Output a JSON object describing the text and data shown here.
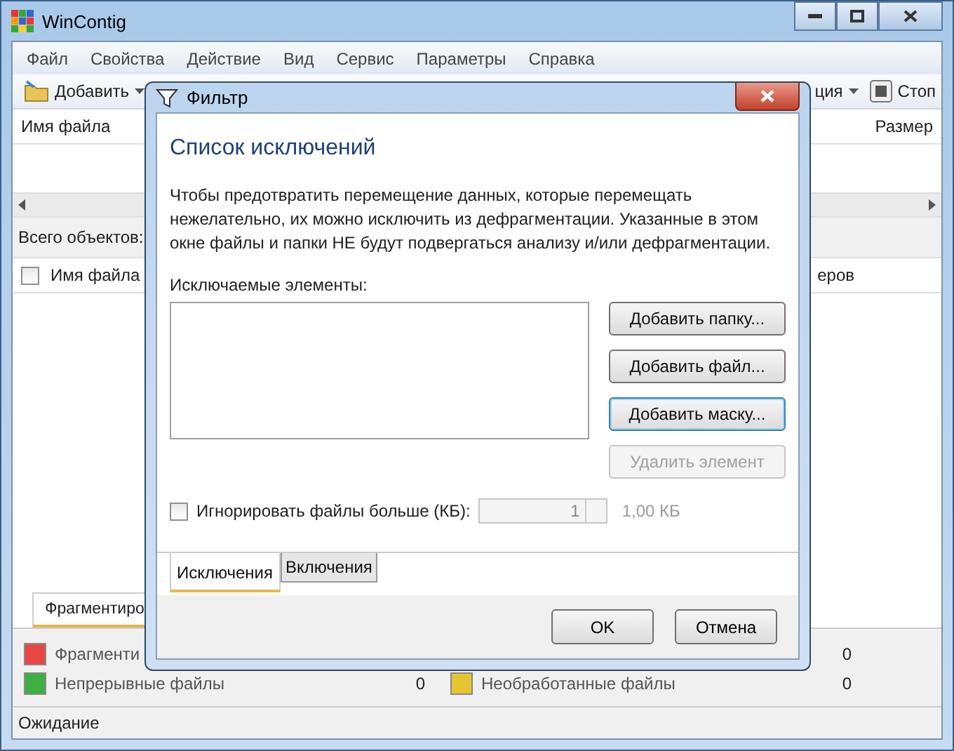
{
  "window": {
    "title": "WinContig"
  },
  "menu": [
    "Файл",
    "Свойства",
    "Действие",
    "Вид",
    "Сервис",
    "Параметры",
    "Справка"
  ],
  "toolbar": [
    {
      "label": "Добавить",
      "dropdown": true
    },
    {
      "label": "ция",
      "dropdown": true
    },
    {
      "label": "Стоп",
      "dropdown": false
    }
  ],
  "file_list": {
    "columns": [
      "Имя файла",
      "Размер"
    ]
  },
  "total_label": "Всего объектов:",
  "second_list": {
    "columns": [
      {
        "label": "Имя файла",
        "checked": false
      },
      {
        "label": "еров"
      }
    ]
  },
  "bottom_tabs": [
    {
      "label": "Фрагментиро",
      "selected": true
    }
  ],
  "legend": [
    {
      "label": "Фрагменти",
      "color": "#e84545"
    },
    {
      "count": "0"
    },
    {
      "label": "Непрерывные файлы",
      "count": "0",
      "color": "#3cb043"
    },
    {
      "label": "Необработанные файлы",
      "count": "0",
      "color": "#e6c630"
    }
  ],
  "status_bar": "Ожидание",
  "dialog": {
    "title": "Фильтр",
    "heading": "Список исключений",
    "description": "Чтобы предотвратить перемещение данных, которые перемещать нежелательно, их можно исключить из дефрагментации. Указанные в этом окне файлы и папки НЕ будут подвергаться анализу и/или дефрагментации.",
    "list_label": "Исключаемые элементы:",
    "buttons": [
      {
        "label": "Добавить папку...",
        "disabled": false,
        "focused": false
      },
      {
        "label": "Добавить файл...",
        "disabled": false,
        "focused": false
      },
      {
        "label": "Добавить маску...",
        "disabled": false,
        "focused": true
      },
      {
        "label": "Удалить элемент",
        "disabled": true,
        "focused": false
      }
    ],
    "size_limit": {
      "label": "Игнорировать файлы больше (КБ):",
      "checked": false,
      "value": "1",
      "reading": "1,00 КБ"
    },
    "tabs": [
      {
        "label": "Исключения",
        "selected": true
      },
      {
        "label": "Включения",
        "selected": false
      }
    ],
    "footer_buttons": [
      "OK",
      "Отмена"
    ]
  }
}
